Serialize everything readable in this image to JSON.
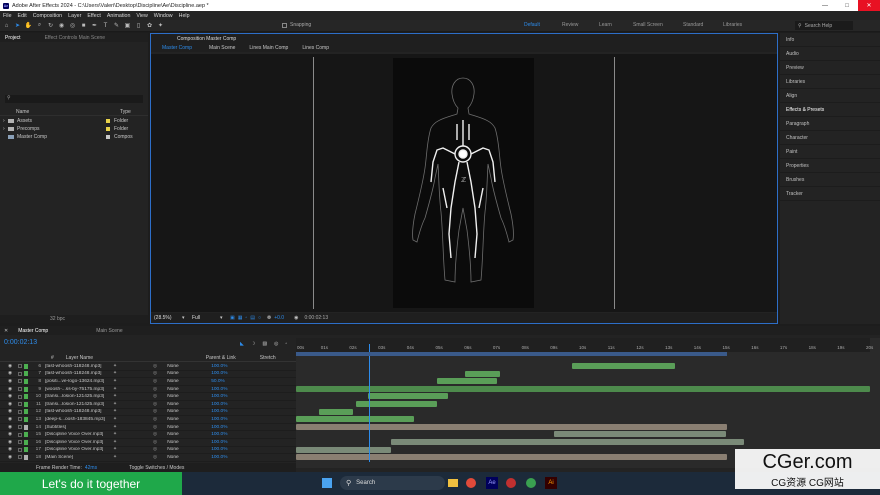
{
  "window": {
    "title": "Adobe After Effects 2024 - C:\\Users\\Valeri\\Desktop\\Discipline\\Ae\\Discipline.aep *",
    "app_icon": "Ae"
  },
  "menu": [
    "File",
    "Edit",
    "Composition",
    "Layer",
    "Effect",
    "Animation",
    "View",
    "Window",
    "Help"
  ],
  "toolbar": {
    "snapping_label": "Snapping",
    "workspaces": [
      "Default",
      "Review",
      "Learn",
      "Small Screen",
      "Standard",
      "Libraries"
    ],
    "active_workspace": "Default",
    "search_placeholder": "Search Help"
  },
  "project": {
    "tabs": [
      "Project",
      "Effect Controls Main Scene"
    ],
    "columns": {
      "name": "Name",
      "type": "Type"
    },
    "items": [
      {
        "name": "Assets",
        "type": "Folder",
        "color": "#e8d24a"
      },
      {
        "name": "Precomps",
        "type": "Folder",
        "color": "#e8d24a"
      },
      {
        "name": "Master Comp",
        "type": "Compos",
        "color": "#c8c8c8"
      }
    ],
    "bpc": "32 bpc"
  },
  "composition": {
    "tab": "Composition Master Comp",
    "breadcrumbs": [
      "Master Comp",
      "Main Scene",
      "Lines Main Comp",
      "Lines Comp"
    ],
    "zoom": "(28.5%)",
    "resolution": "Full",
    "exposure": "+0.0",
    "timecode": "0:00:02:13"
  },
  "right_panels": [
    "Info",
    "Audio",
    "Preview",
    "Libraries",
    "Align",
    "Effects & Presets",
    "Paragraph",
    "Character",
    "Paint",
    "Properties",
    "Brushes",
    "Tracker"
  ],
  "timeline": {
    "tabs": [
      "Master Comp",
      "Main Scene"
    ],
    "timecode": "0:00:02:13",
    "headers": {
      "num": "#",
      "layer_name": "Layer Name",
      "parent": "Parent & Link",
      "stretch": "Stretch"
    },
    "ruler": [
      "00s",
      "01s",
      "02s",
      "03s",
      "04s",
      "05s",
      "06s",
      "07s",
      "08s",
      "09s",
      "10s",
      "11s",
      "12s",
      "13s",
      "14s",
      "15s",
      "16s",
      "17s",
      "18s",
      "19s",
      "20s"
    ],
    "layers": [
      {
        "num": "6",
        "name": "[fast-whoosh-118248.mp3]",
        "parent": "None",
        "stretch": "100.0%",
        "color": "#4caf50",
        "start": 9.6,
        "end": 13.2,
        "bar": "#5a9e58"
      },
      {
        "num": "7",
        "name": "[fast-whoosh-118248.mp3]",
        "parent": "None",
        "stretch": "100.0%",
        "color": "#4caf50",
        "start": 5.9,
        "end": 7.1,
        "bar": "#5a9e58"
      },
      {
        "num": "8",
        "name": "[positi...ve-logo-13624.mp3]",
        "parent": "None",
        "stretch": "50.0%",
        "color": "#4caf50",
        "start": 4.9,
        "end": 7.0,
        "bar": "#5a9e58"
      },
      {
        "num": "9",
        "name": "[woosh-...ss-by-75175.mp3]",
        "parent": "None",
        "stretch": "100.0%",
        "color": "#4caf50",
        "start": 0.0,
        "end": 20.0,
        "bar": "#4d8a4c"
      },
      {
        "num": "10",
        "name": "[transi...losion-121425.mp3]",
        "parent": "None",
        "stretch": "100.0%",
        "color": "#4caf50",
        "start": 2.5,
        "end": 5.3,
        "bar": "#5a9e58"
      },
      {
        "num": "11",
        "name": "[transi...losion-121425.mp3]",
        "parent": "None",
        "stretch": "100.0%",
        "color": "#4caf50",
        "start": 2.1,
        "end": 4.9,
        "bar": "#5a9e58"
      },
      {
        "num": "12",
        "name": "[fast-whoosh-118248.mp3]",
        "parent": "None",
        "stretch": "100.0%",
        "color": "#4caf50",
        "start": 0.8,
        "end": 2.0,
        "bar": "#5a9e58"
      },
      {
        "num": "13",
        "name": "[deep-s...oosh-183845.mp3]",
        "parent": "None",
        "stretch": "100.0%",
        "color": "#4caf50",
        "start": 0.0,
        "end": 4.1,
        "bar": "#5a9e58"
      },
      {
        "num": "14",
        "name": "[Subtitles]",
        "parent": "None",
        "stretch": "100.0%",
        "color": "#b0b0b0",
        "start": 0.0,
        "end": 15.0,
        "bar": "#8a7f72"
      },
      {
        "num": "15",
        "name": "[Discipline Voice Over.mp3]",
        "parent": "None",
        "stretch": "100.0%",
        "color": "#4caf50",
        "start": 9.0,
        "end": 15.0,
        "bar": "#7a8a78"
      },
      {
        "num": "16",
        "name": "[Discipline Voice Over.mp3]",
        "parent": "None",
        "stretch": "100.0%",
        "color": "#4caf50",
        "start": 3.3,
        "end": 15.6,
        "bar": "#7a8a78"
      },
      {
        "num": "17",
        "name": "[Discipline Voice Over.mp3]",
        "parent": "None",
        "stretch": "100.0%",
        "color": "#4caf50",
        "start": 0.0,
        "end": 3.3,
        "bar": "#7a8a78"
      },
      {
        "num": "18",
        "name": "[Main Scene]",
        "parent": "None",
        "stretch": "100.0%",
        "color": "#b0b0b0",
        "start": 0.0,
        "end": 15.0,
        "bar": "#8a7f72"
      }
    ],
    "duration": 20,
    "playhead": 2.54,
    "work_area_end": 15.0,
    "footer": {
      "render_label": "Frame Render Time:",
      "render_value": "42ms",
      "toggle": "Toggle Switches / Modes"
    }
  },
  "overlay_text": "Let's do it together",
  "watermark": {
    "line1": "CGer.com",
    "line2": "CG资源 CG网站"
  },
  "taskbar": {
    "search": "Search"
  }
}
